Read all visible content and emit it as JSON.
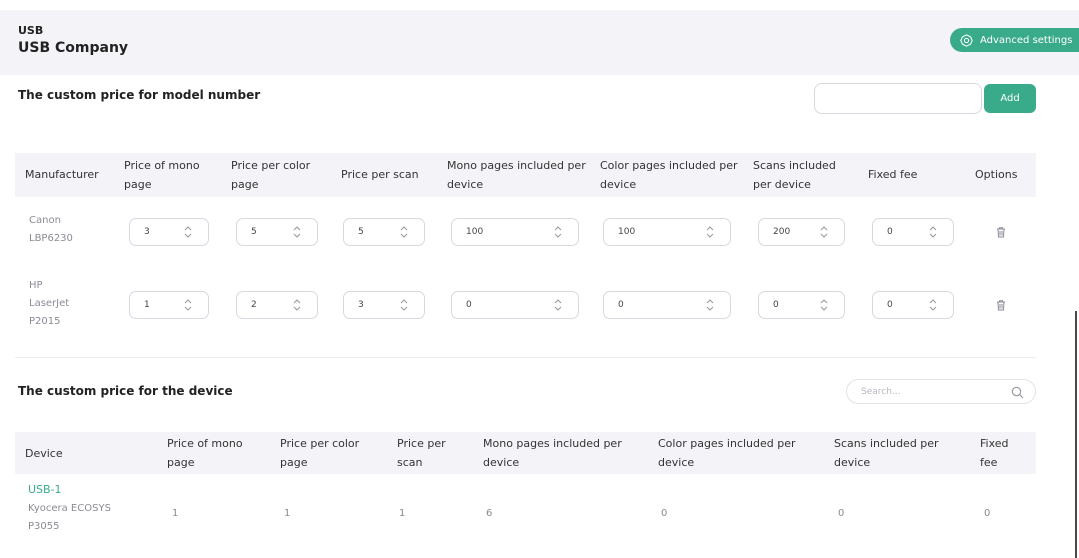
{
  "header": {
    "kicker": "USB",
    "company": "USB Company",
    "advanced_label": "Advanced settings"
  },
  "model_section": {
    "title": "The custom price for model number",
    "input_value": "",
    "add_label": "Add",
    "columns": [
      "Manufacturer",
      "Price of mono page",
      "Price per color page",
      "Price per scan",
      "Mono pages included per device",
      "Color pages included per device",
      "Scans included per device",
      "Fixed fee",
      "Options"
    ],
    "rows": [
      {
        "manufacturer_lines": [
          "Canon",
          "LBP6230"
        ],
        "values": [
          "3",
          "5",
          "5",
          "100",
          "100",
          "200",
          "0"
        ]
      },
      {
        "manufacturer_lines": [
          "HP",
          "LaserJet",
          "P2015"
        ],
        "values": [
          "1",
          "2",
          "3",
          "0",
          "0",
          "0",
          "0"
        ]
      }
    ]
  },
  "device_section": {
    "title": "The custom price for the device",
    "search_placeholder": "Search...",
    "columns": [
      "Device",
      "Price of mono page",
      "Price per color page",
      "Price per scan",
      "Mono pages included per device",
      "Color pages included per device",
      "Scans included per device",
      "Fixed fee"
    ],
    "rows": [
      {
        "device_id": "USB-1",
        "device_model_lines": [
          "Kyocera ECOSYS",
          "P3055"
        ],
        "values": [
          "1",
          "1",
          "1",
          "6",
          "0",
          "0",
          "0"
        ]
      }
    ]
  },
  "colors": {
    "accent": "#3aab8a",
    "header_band": "#f3f3f8",
    "muted_text": "#8a8a95"
  },
  "icons": {
    "advanced": "gear-icon",
    "delete": "trash-icon",
    "search": "search-icon",
    "spinner": "spinner-arrows-icon"
  }
}
